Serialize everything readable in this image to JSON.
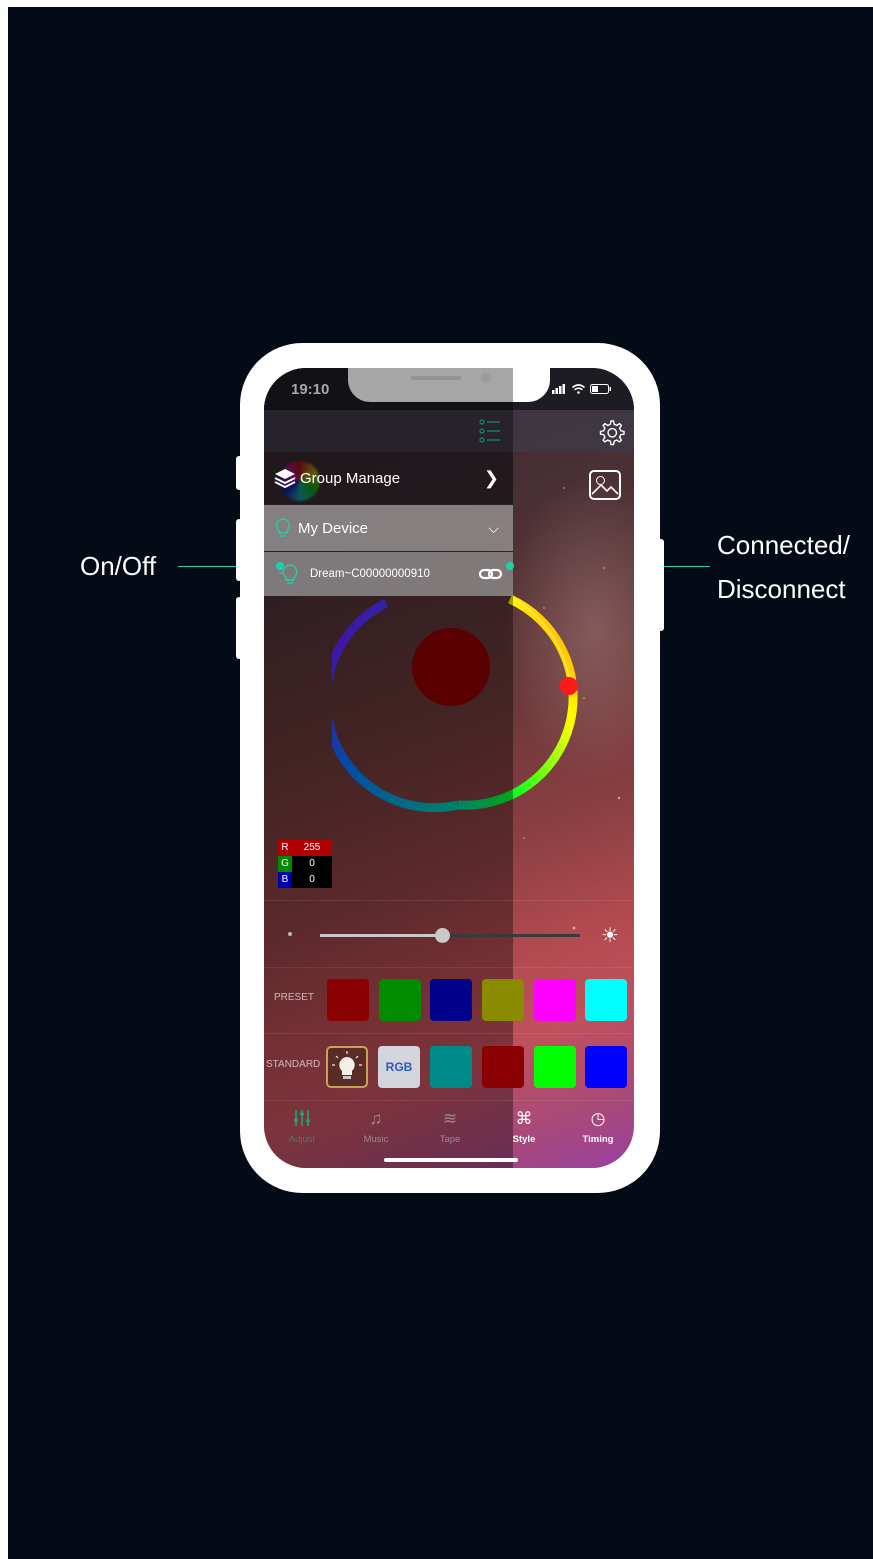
{
  "callouts": {
    "left_label": "On/Off",
    "right_label_line1": "Connected/",
    "right_label_line2": "Disconnect"
  },
  "status_bar": {
    "time": "19:10",
    "icons": "cellular-icon wifi-icon battery-icon"
  },
  "drawer": {
    "group_manage": "Group Manage",
    "my_device": "My Device",
    "device_name": "Dream~C00000000910"
  },
  "icons": {
    "top_bar": [
      "list-menu-icon",
      "gear-icon",
      "image-icon"
    ],
    "drawer": [
      "layers-icon",
      "bulb-icon",
      "link-icon",
      "chevron-right-icon",
      "chevron-down-icon"
    ]
  },
  "color_picker": {
    "r": "255",
    "g": "0",
    "b": "0",
    "selected_color": "#8b0000"
  },
  "brightness": {
    "value": 0.47
  },
  "preset": {
    "label": "PRESET",
    "swatches": [
      "#8b0000",
      "#008b00",
      "#00008b",
      "#8b8b00",
      "#ff00ff",
      "#00ffff"
    ]
  },
  "standard": {
    "label": "STANDARD",
    "rgb_label": "RGB",
    "swatches": [
      "#008b8b",
      "#8b0000",
      "#00ff00",
      "#0000ff"
    ]
  },
  "tabs": [
    {
      "label": "Adjust",
      "icon": "sliders-icon"
    },
    {
      "label": "Music",
      "icon": "music-note-icon"
    },
    {
      "label": "Tape",
      "icon": "wave-icon"
    },
    {
      "label": "Style",
      "icon": "command-icon"
    },
    {
      "label": "Timing",
      "icon": "timer-icon"
    }
  ],
  "colors": {
    "accent": "#1fd1a9",
    "active_tab": "#1fa37a",
    "background": "#050b16"
  }
}
